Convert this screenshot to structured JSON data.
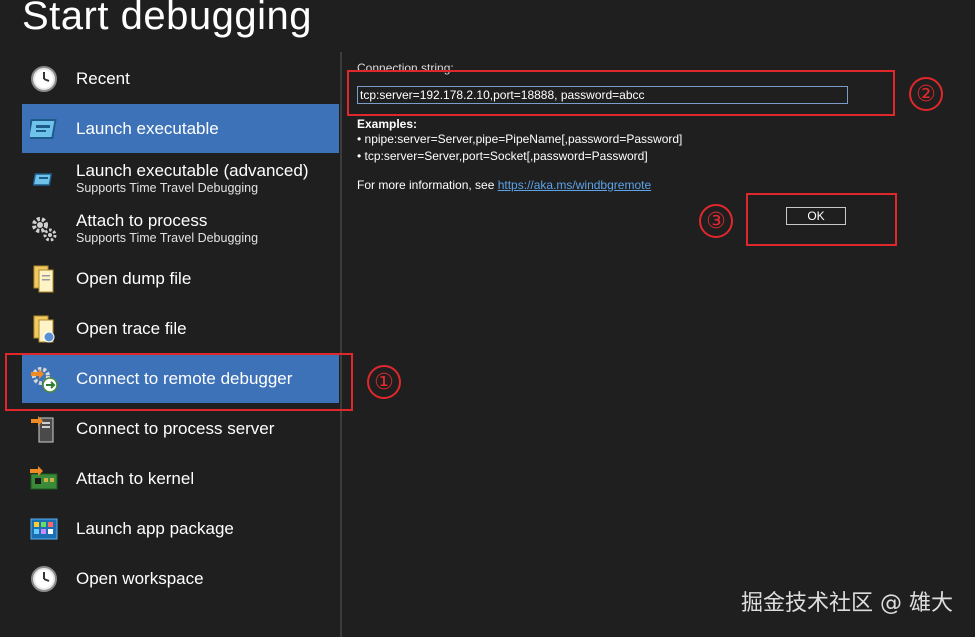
{
  "window": {
    "title": "Start debugging"
  },
  "sidebar": {
    "items": [
      {
        "label": "Recent",
        "sub": ""
      },
      {
        "label": "Launch executable",
        "sub": ""
      },
      {
        "label": "Launch executable (advanced)",
        "sub": "Supports Time Travel Debugging"
      },
      {
        "label": "Attach to process",
        "sub": "Supports Time Travel Debugging"
      },
      {
        "label": "Open dump file",
        "sub": ""
      },
      {
        "label": "Open trace file",
        "sub": ""
      },
      {
        "label": "Connect to remote debugger",
        "sub": ""
      },
      {
        "label": "Connect to process server",
        "sub": ""
      },
      {
        "label": "Attach to kernel",
        "sub": ""
      },
      {
        "label": "Launch app package",
        "sub": ""
      },
      {
        "label": "Open workspace",
        "sub": ""
      }
    ]
  },
  "main": {
    "connection_label": "Connection string:",
    "connection_value": "tcp:server=192.178.2.10,port=18888, password=abcc",
    "examples_title": "Examples:",
    "examples": [
      "• npipe:server=Server,pipe=PipeName[,password=Password]",
      "• tcp:server=Server,port=Socket[,password=Password]"
    ],
    "more_info_text": "For more information, see ",
    "more_info_link": "https://aka.ms/windbgremote",
    "ok_label": "OK"
  },
  "annotations": {
    "callout_1": "①",
    "callout_2": "②",
    "callout_3": "③"
  },
  "watermark": "掘金技术社区 @ 雄大",
  "colors": {
    "background": "#1f1f1f",
    "selected": "#3d72b8",
    "highlight": "#e0282c",
    "link": "#5da3e8"
  }
}
